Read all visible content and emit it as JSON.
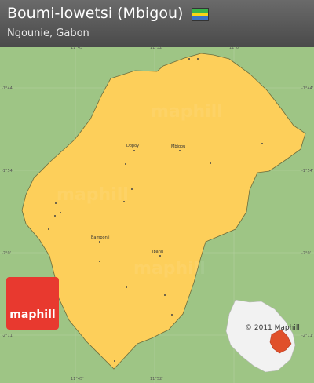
{
  "header": {
    "title": "Boumi-lowetsi (Mbigou)",
    "subtitle": "Ngounie, Gabon",
    "flag_colors": [
      "#3ab54a",
      "#f9d616",
      "#3a75c4"
    ]
  },
  "map": {
    "land_color": "#9ec585",
    "region_color": "#fdcf5a",
    "grid_color": "#b5cfa0",
    "top_ticks": [
      "11°45'",
      "11°52'",
      "12°0'"
    ],
    "left_ticks": [
      "-1°44'",
      "-1°54'",
      "-2°0'",
      "-2°11'"
    ],
    "right_ticks": [
      "-1°44'",
      "-1°54'",
      "-2°0'",
      "-2°11'"
    ],
    "bottom_ticks": [
      "11°45'",
      "11°52'"
    ],
    "places": [
      "Dopoy",
      "Mbigou",
      "Bamponji",
      "Ibanu"
    ],
    "watermark": "maphill"
  },
  "logo": {
    "text": "maphill"
  },
  "copyright": "© 2011 Maphill"
}
